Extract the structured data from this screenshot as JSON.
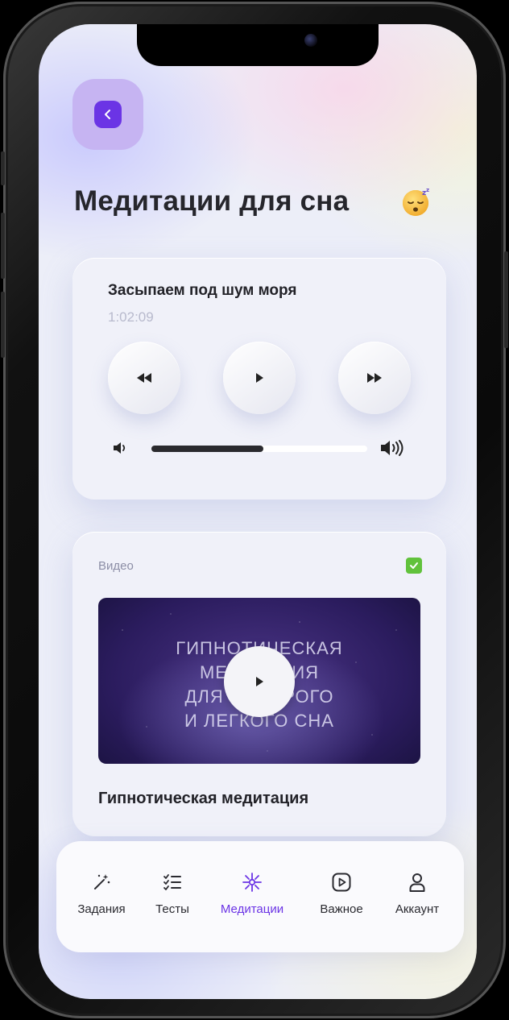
{
  "header": {
    "title": "Медитации для сна",
    "title_emoji": "sleeping-face-emoji"
  },
  "player": {
    "track_title": "Засыпаем под шум моря",
    "duration": "1:02:09",
    "volume_level": 0.52
  },
  "video": {
    "label": "Видео",
    "overlay_lines": [
      "ГИПНОТИЧЕСКАЯ",
      "МЕДИТАЦИЯ",
      "ДЛЯ БЫСТРОГО",
      "И ЛЕГКОГО СНА"
    ],
    "title": "Гипнотическая медитация"
  },
  "tabs": [
    {
      "label": "Задания",
      "icon": "magic-wand-icon"
    },
    {
      "label": "Тесты",
      "icon": "checklist-icon"
    },
    {
      "label": "Медитации",
      "icon": "sparkle-icon",
      "active": true
    },
    {
      "label": "Важное",
      "icon": "video-play-icon"
    },
    {
      "label": "Аккаунт",
      "icon": "user-icon"
    }
  ],
  "colors": {
    "accent": "#6b34e5",
    "accent_soft": "#c6b4f2",
    "check": "#61c23c"
  }
}
